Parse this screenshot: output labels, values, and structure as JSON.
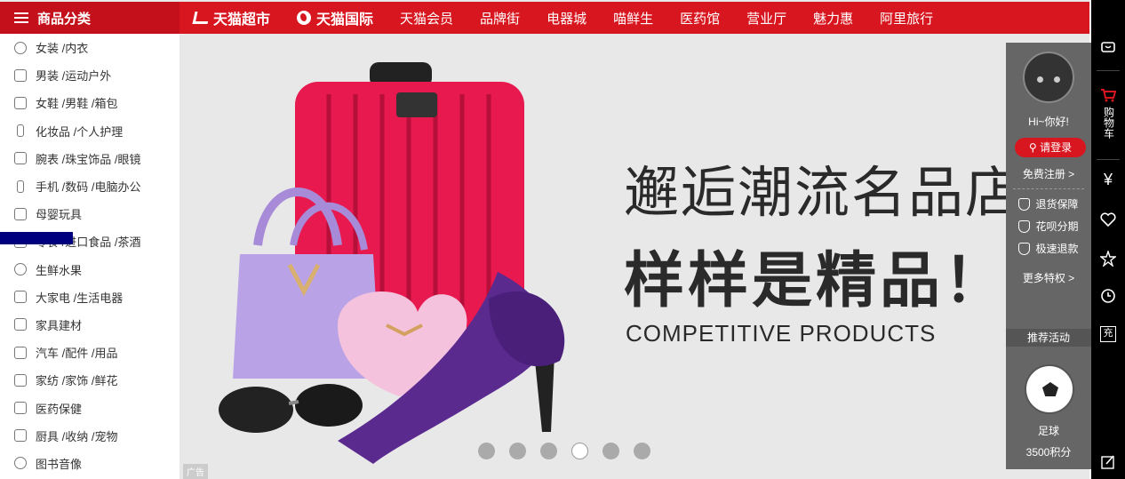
{
  "nav": {
    "category_title": "商品分类",
    "links": [
      "天猫超市",
      "天猫国际",
      "天猫会员",
      "品牌街",
      "电器城",
      "喵鲜生",
      "医药馆",
      "营业厅",
      "魅力惠",
      "阿里旅行"
    ]
  },
  "categories": [
    "女装 /内衣",
    "男装 /运动户外",
    "女鞋 /男鞋 /箱包",
    "化妆品 /个人护理",
    "腕表 /珠宝饰品 /眼镜",
    "手机 /数码 /电脑办公",
    "母婴玩具",
    "零食 /进口食品 /茶酒",
    "生鲜水果",
    "大家电 /生活电器",
    "家具建材",
    "汽车 /配件 /用品",
    "家纺 /家饰 /鲜花",
    "医药保健",
    "厨具 /收纳 /宠物",
    "图书音像"
  ],
  "banner": {
    "headline1": "邂逅潮流名品店",
    "headline2": "样样是精品！",
    "subline": "COMPETITIVE PRODUCTS",
    "ad_tag": "广告",
    "active_slide": 4,
    "slide_count": 6
  },
  "user_panel": {
    "greeting": "Hi~你好!",
    "login": "请登录",
    "register": "免费注册 >",
    "perks": [
      "退货保障",
      "花呗分期",
      "极速退款"
    ],
    "more_perks": "更多特权 >",
    "recommend_title": "推荐活动",
    "item_name": "足球",
    "item_points": "3500积分"
  },
  "toolbar": {
    "cart_label": "购物车",
    "charge_label": "充",
    "yen": "¥"
  },
  "colors": {
    "brand_red": "#d8161f",
    "dark_red": "#c4101a"
  }
}
